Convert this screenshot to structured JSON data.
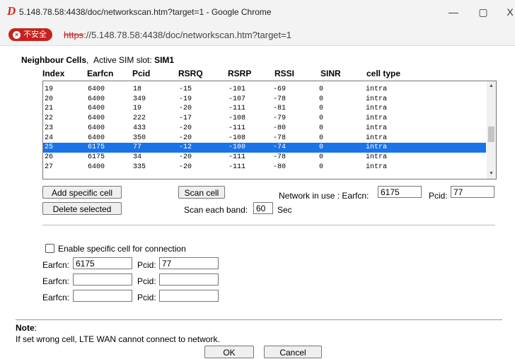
{
  "window": {
    "title": "5.148.78.58:4438/doc/networkscan.htm?target=1 - Google Chrome",
    "controls": {
      "minimize": "—",
      "maximize": "▢",
      "close": "X"
    }
  },
  "address": {
    "badge": "不安全",
    "scheme": "https",
    "rest": "://5.148.78.58:4438/doc/networkscan.htm?target=1"
  },
  "section": {
    "title": "Neighbour Cells",
    "sim_label": "Active SIM slot:",
    "sim_value": "SIM1"
  },
  "table": {
    "columns": [
      "Index",
      "Earfcn",
      "Pcid",
      "RSRQ",
      "RSRP",
      "RSSI",
      "SINR",
      "cell type"
    ],
    "rows": [
      [
        "19",
        "6400",
        "18",
        "-15",
        "-101",
        "-69",
        "0",
        "intra"
      ],
      [
        "20",
        "6400",
        "349",
        "-19",
        "-107",
        "-78",
        "0",
        "intra"
      ],
      [
        "21",
        "6400",
        "19",
        "-20",
        "-111",
        "-81",
        "0",
        "intra"
      ],
      [
        "22",
        "6400",
        "222",
        "-17",
        "-108",
        "-79",
        "0",
        "intra"
      ],
      [
        "23",
        "6400",
        "433",
        "-20",
        "-111",
        "-80",
        "0",
        "intra"
      ],
      [
        "24",
        "6400",
        "350",
        "-20",
        "-108",
        "-78",
        "0",
        "intra"
      ],
      [
        "25",
        "6175",
        "77",
        "-12",
        "-100",
        "-74",
        "0",
        "intra"
      ],
      [
        "26",
        "6175",
        "34",
        "-20",
        "-111",
        "-78",
        "0",
        "intra"
      ],
      [
        "27",
        "6400",
        "335",
        "-20",
        "-111",
        "-80",
        "0",
        "intra"
      ]
    ],
    "selected_index": "25"
  },
  "actions": {
    "add_cell": "Add specific cell",
    "delete_selected": "Delete selected",
    "scan_cell": "Scan cell",
    "scan_each_band_label": "Scan each band:",
    "scan_each_band_value": "60",
    "scan_unit": "Sec",
    "network_label": "Network in use : Earfcn:",
    "network_earfcn": "6175",
    "pcid_label": "Pcid:",
    "network_pcid": "77"
  },
  "specific": {
    "enable_label": "Enable specific cell for connection",
    "enabled": false,
    "earfcn_label": "Earfcn:",
    "pcid_label": "Pcid:",
    "entries": [
      {
        "earfcn": "6175",
        "pcid": "77"
      },
      {
        "earfcn": "",
        "pcid": ""
      },
      {
        "earfcn": "",
        "pcid": ""
      }
    ]
  },
  "note": {
    "title": "Note",
    "text": "If set wrong cell, LTE WAN cannot connect to network."
  },
  "buttons": {
    "ok": "OK",
    "cancel": "Cancel"
  }
}
